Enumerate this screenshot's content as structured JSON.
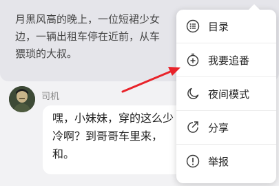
{
  "narration": {
    "line1": "月黑风高的晚上，一位短裙少女",
    "line2": "边，一辆出租车停在近前，从车",
    "line3": "猥琐的大叔。"
  },
  "message": {
    "speaker": "司机",
    "line1": "嘿，小妹妹，穿的这么少",
    "line2": "冷啊？到哥哥车里来，",
    "line3": "和。"
  },
  "menu": {
    "items": [
      {
        "label": "目录",
        "icon": "list-icon"
      },
      {
        "label": "我要追番",
        "icon": "add-follow-icon"
      },
      {
        "label": "夜间模式",
        "icon": "moon-icon"
      },
      {
        "label": "分享",
        "icon": "share-icon"
      },
      {
        "label": "举报",
        "icon": "report-icon"
      }
    ]
  },
  "colors": {
    "annotation_arrow": "#e8232a"
  }
}
